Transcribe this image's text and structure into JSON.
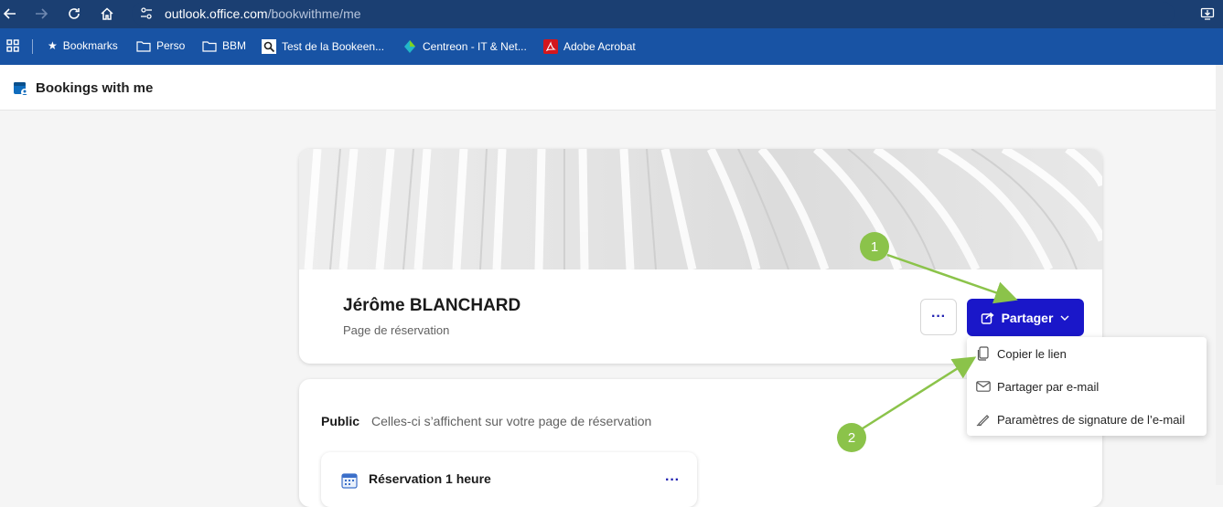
{
  "browser": {
    "url_host": "outlook.office.com",
    "url_path": "/bookwithme/me"
  },
  "bookmarks": [
    {
      "label": "Bookmarks",
      "icon": "star-icon"
    },
    {
      "label": "Perso",
      "icon": "folder-icon"
    },
    {
      "label": "BBM",
      "icon": "folder-icon"
    },
    {
      "label": "Test de la Bookeen...",
      "icon": "search-favicon"
    },
    {
      "label": "Centreon - IT & Net...",
      "icon": "centreon-favicon"
    },
    {
      "label": "Adobe Acrobat",
      "icon": "acrobat-favicon"
    }
  ],
  "app": {
    "title": "Bookings with me"
  },
  "profile": {
    "name": "Jérôme BLANCHARD",
    "subtitle": "Page de réservation",
    "more_label": "···",
    "share_label": "Partager"
  },
  "share_menu": [
    {
      "label": "Copier le lien",
      "icon": "copy-icon"
    },
    {
      "label": "Partager par e-mail",
      "icon": "mail-icon"
    },
    {
      "label": "Paramètres de signature de l’e-mail",
      "icon": "signature-icon"
    }
  ],
  "public_section": {
    "label": "Public",
    "description": "Celles-ci s’affichent sur votre page de réservation"
  },
  "services": [
    {
      "title": "Réservation 1 heure"
    }
  ],
  "annotations": [
    {
      "number": "1"
    },
    {
      "number": "2"
    }
  ],
  "colors": {
    "browser_bar": "#1b3f72",
    "bookmarks_bar": "#1853a4",
    "primary_button": "#1a17c9",
    "annotation_green": "#8bc34a"
  }
}
